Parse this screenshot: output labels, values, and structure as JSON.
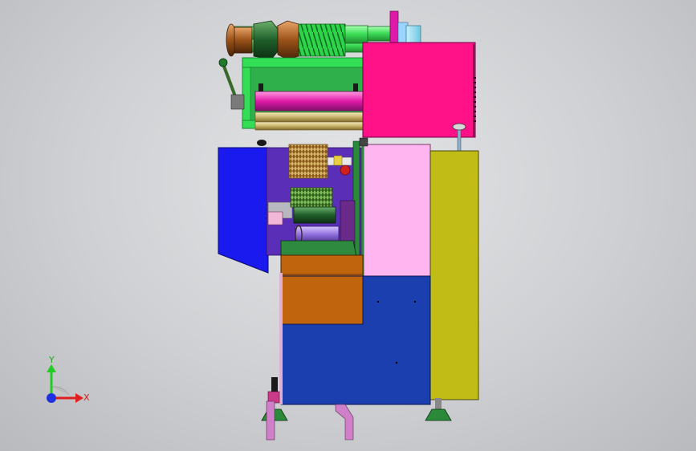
{
  "view": {
    "background_color": "#d6d7da"
  },
  "model": {
    "name": "",
    "colors": {
      "top_housing": "#ff1188",
      "left_cover": "#1a1aee",
      "right_panel": "#c2bd16",
      "light_panel": "#ffb5f0",
      "base_body": "#1b3fae",
      "orange_block": "#c0650e",
      "green_frame": "#33dd55",
      "purple_rear": "#5b2eb8",
      "magenta_roller": "#e01aa8",
      "gold_roller": "#c9b36a"
    }
  },
  "triad": {
    "x_label": "X",
    "y_label": "Y",
    "x_color": "#e02020",
    "y_color": "#22cc22",
    "origin_color": "#2030e0"
  }
}
